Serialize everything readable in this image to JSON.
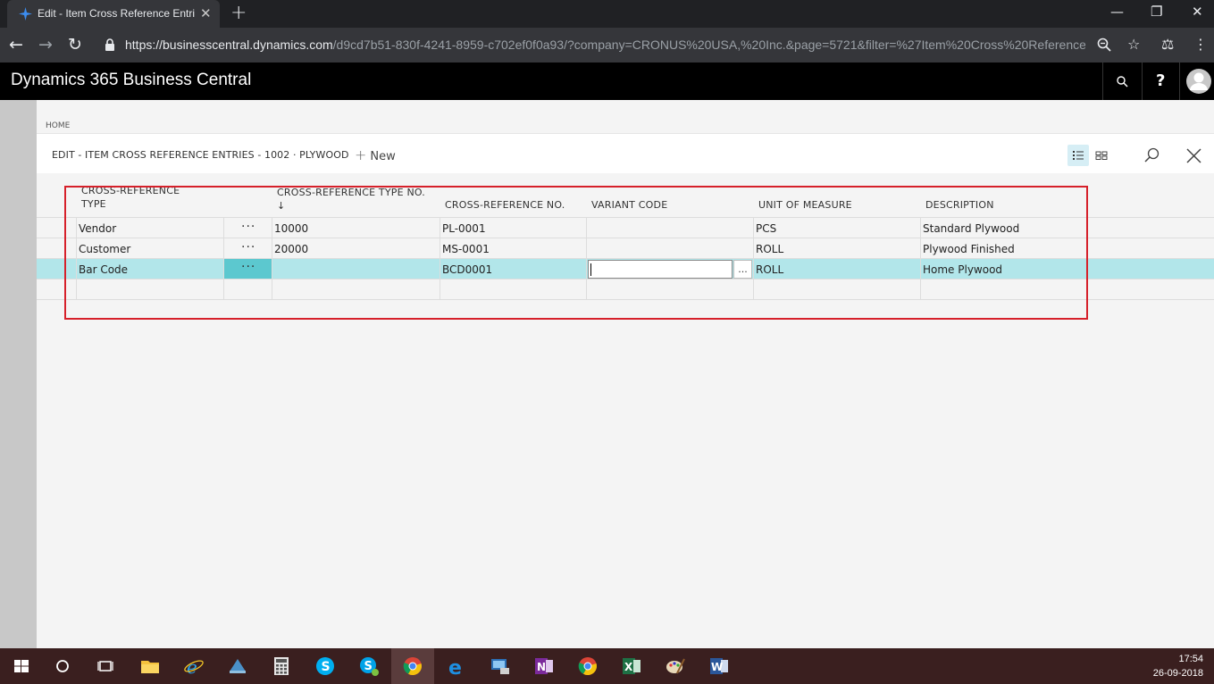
{
  "browser": {
    "tab_title": "Edit - Item Cross Reference Entrie",
    "tab_close": "✕",
    "new_tab": "+",
    "url_host": "https://businesscentral.dynamics.com",
    "url_rest": "/d9cd7b51-830f-4241-8959-c702ef0f0a93/?company=CRONUS%20USA,%20Inc.&page=5721&filter=%27Item%20Cross%20Reference...",
    "window_controls": {
      "minimize": "—",
      "restore": "❐",
      "close": "✕"
    }
  },
  "app": {
    "title": "Dynamics 365 Business Central",
    "help": "?"
  },
  "page": {
    "breadcrumb": "HOME",
    "title": "EDIT - ITEM CROSS REFERENCE ENTRIES - 1002 · PLYWOOD",
    "new_label": "New",
    "new_plus": "+"
  },
  "grid": {
    "headers": {
      "type_line1": "CROSS-REFERENCE",
      "type_line2": "TYPE",
      "type_no": "CROSS-REFERENCE TYPE NO.",
      "sort_arrow": "↓",
      "ref_no": "CROSS-REFERENCE NO.",
      "variant": "VARIANT CODE",
      "uom": "UNIT OF MEASURE",
      "description": "DESCRIPTION"
    },
    "dots": "···",
    "lookup": "...",
    "rows": [
      {
        "type": "Vendor",
        "type_no": "10000",
        "ref_no": "PL-0001",
        "variant": "",
        "uom": "PCS",
        "description": "Standard Plywood"
      },
      {
        "type": "Customer",
        "type_no": "20000",
        "ref_no": "MS-0001",
        "variant": "",
        "uom": "ROLL",
        "description": "Plywood Finished"
      },
      {
        "type": "Bar Code",
        "type_no": "",
        "ref_no": "BCD0001",
        "variant": "",
        "uom": "ROLL",
        "description": "Home Plywood"
      }
    ]
  },
  "taskbar": {
    "time": "17:54",
    "date": "26-09-2018"
  },
  "colors": {
    "selected_row": "#b2e6ea",
    "dots_active": "#5cc8cf",
    "highlight_box": "#d6202a",
    "app_header": "#000000"
  }
}
